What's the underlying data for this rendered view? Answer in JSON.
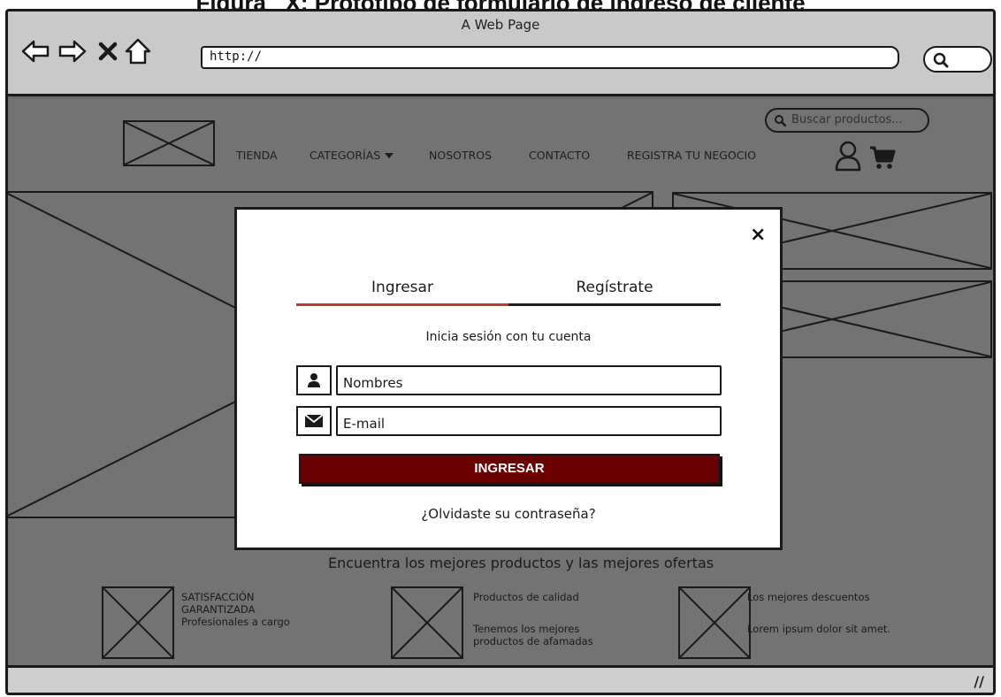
{
  "caption": "Figura_ X: Prototipo de formulario de ingreso de cliente",
  "browser": {
    "window_title": "A Web Page",
    "url": "http://",
    "icons": [
      "back-arrow-icon",
      "forward-arrow-icon",
      "close-x-icon",
      "home-icon",
      "search-icon"
    ]
  },
  "site": {
    "nav": [
      "TIENDA",
      "CATEGORÍAS",
      "NOSOTROS",
      "CONTACTO",
      "REGISTRA TU NEGOCIO"
    ],
    "search_placeholder": "Buscar productos...",
    "icons": [
      "user-icon",
      "cart-icon",
      "caret-down-icon"
    ],
    "tagline": "Encuentra los mejores productos y las mejores ofertas",
    "features": [
      {
        "title": "SATISFACCIÓN GARANTIZADA",
        "title_l1": "SATISFACCIÓN",
        "title_l2": "GARANTIZADA",
        "text": "Profesionales a cargo"
      },
      {
        "title": "Productos de calidad",
        "text_l1": "Tenemos los mejores",
        "text_l2": "productos de afamadas"
      },
      {
        "title": "Los mejores descuentos",
        "text": "Lorem ipsum dolor sit amet."
      }
    ]
  },
  "modal": {
    "close": "×",
    "tabs": [
      "Ingresar",
      "Regístrate"
    ],
    "active_tab": "Ingresar",
    "subtitle": "Inicia sesión con tu cuenta",
    "name_field": "Nombres",
    "email_field": "E-mail",
    "submit": "INGRESAR",
    "forgot": "¿Olvidaste su contraseña?"
  },
  "colors": {
    "active_tab": "#c0392b",
    "submit_bg": "#6b0000",
    "overlay": "#737373",
    "chrome": "#c9c9c9"
  }
}
